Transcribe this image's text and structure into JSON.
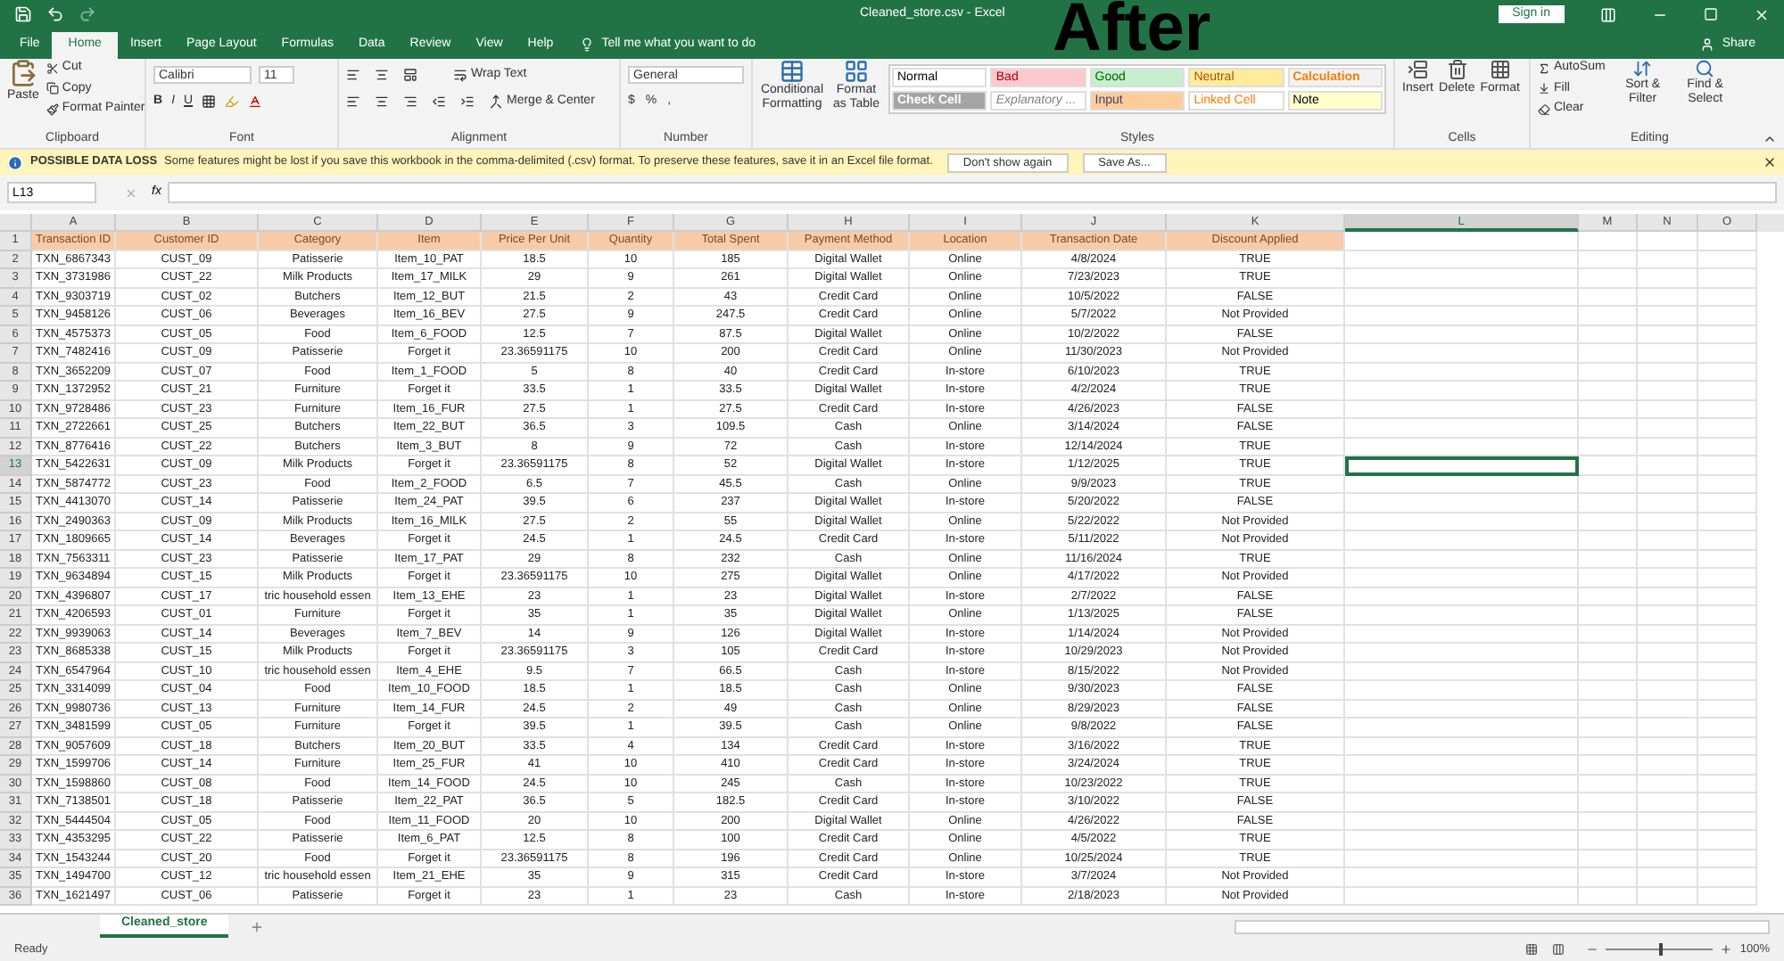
{
  "title_bar": {
    "filename": "Cleaned_store.csv  -  Excel",
    "overlay_label": "After",
    "sign_in": "Sign in",
    "share": "Share"
  },
  "menu_tabs": [
    {
      "label": "File",
      "selected": false
    },
    {
      "label": "Home",
      "selected": true
    },
    {
      "label": "Insert",
      "selected": false
    },
    {
      "label": "Page Layout",
      "selected": false
    },
    {
      "label": "Formulas",
      "selected": false
    },
    {
      "label": "Data",
      "selected": false
    },
    {
      "label": "Review",
      "selected": false
    },
    {
      "label": "View",
      "selected": false
    },
    {
      "label": "Help",
      "selected": false
    }
  ],
  "tell_me": "Tell me what you want to do",
  "ribbon": {
    "clipboard": {
      "paste": "Paste",
      "cut": "Cut",
      "copy": "Copy",
      "format_painter": "Format Painter",
      "label": "Clipboard"
    },
    "font": {
      "name": "Calibri",
      "size": "11",
      "buttons": [
        "B",
        "I",
        "U"
      ],
      "label": "Font"
    },
    "alignment": {
      "wrap": "Wrap Text",
      "merge": "Merge & Center",
      "label": "Alignment"
    },
    "number": {
      "format": "General",
      "symbols": [
        "$",
        "%",
        ","
      ],
      "label": "Number"
    },
    "styles": {
      "conditional": "Conditional Formatting",
      "format_table": "Format as Table",
      "label": "Styles",
      "cells": [
        {
          "label": "Normal",
          "color": "#ffffff",
          "kind": "normal"
        },
        {
          "label": "Bad",
          "color": "#ffc7ce",
          "kind": "bad"
        },
        {
          "label": "Good",
          "color": "#c6efce",
          "kind": "good"
        },
        {
          "label": "Neutral",
          "color": "#ffeb9c",
          "kind": "neutral"
        },
        {
          "label": "Calculation",
          "color": "#f2f2f2",
          "kind": "calculation"
        },
        {
          "label": "Check Cell",
          "color": "#a5a5a5",
          "kind": "check"
        },
        {
          "label": "Explanatory ...",
          "color": "#ffffff",
          "kind": "explanatory"
        },
        {
          "label": "Input",
          "color": "#ffcc99",
          "kind": "input"
        },
        {
          "label": "Linked Cell",
          "color": "#ffffff",
          "kind": "linked"
        },
        {
          "label": "Note",
          "color": "#ffffcc",
          "kind": "note"
        }
      ]
    },
    "cells": {
      "buttons": [
        "Insert",
        "Delete",
        "Format"
      ],
      "label": "Cells"
    },
    "editing": {
      "autosum": "AutoSum",
      "fill": "Fill",
      "clear": "Clear",
      "sort": "Sort & Filter",
      "find": "Find & Select",
      "label": "Editing"
    }
  },
  "info_bar": {
    "title": "POSSIBLE DATA LOSS",
    "message": "Some features might be lost if you save this workbook in the comma-delimited (.csv) format. To preserve these features, save it in an Excel file format.",
    "buttons": [
      "Don't show again",
      "Save As..."
    ]
  },
  "formula_bar": {
    "name_box": "L13",
    "fx": "fx"
  },
  "sheet": {
    "columns": [
      {
        "label": "A",
        "selected": false
      },
      {
        "label": "B",
        "selected": false
      },
      {
        "label": "C",
        "selected": false
      },
      {
        "label": "D",
        "selected": false
      },
      {
        "label": "E",
        "selected": false
      },
      {
        "label": "F",
        "selected": false
      },
      {
        "label": "G",
        "selected": false
      },
      {
        "label": "H",
        "selected": false
      },
      {
        "label": "I",
        "selected": false
      },
      {
        "label": "J",
        "selected": false
      },
      {
        "label": "K",
        "selected": false
      },
      {
        "label": "L",
        "selected": true
      },
      {
        "label": "M",
        "selected": false
      },
      {
        "label": "N",
        "selected": false
      },
      {
        "label": "O",
        "selected": false
      }
    ],
    "header": {
      "number": "1",
      "cells": [
        "Transaction ID",
        "Customer ID",
        "Category",
        "Item",
        "Price Per Unit",
        "Quantity",
        "Total Spent",
        "Payment Method",
        "Location",
        "Transaction Date",
        "Discount Applied"
      ]
    },
    "rows": [
      {
        "number": "2",
        "selected": false,
        "cells": [
          "TXN_6867343",
          "CUST_09",
          "Patisserie",
          "Item_10_PAT",
          "18.5",
          "10",
          "185",
          "Digital Wallet",
          "Online",
          "4/8/2024",
          "TRUE"
        ]
      },
      {
        "number": "3",
        "selected": false,
        "cells": [
          "TXN_3731986",
          "CUST_22",
          "Milk Products",
          "Item_17_MILK",
          "29",
          "9",
          "261",
          "Digital Wallet",
          "Online",
          "7/23/2023",
          "TRUE"
        ]
      },
      {
        "number": "4",
        "selected": false,
        "cells": [
          "TXN_9303719",
          "CUST_02",
          "Butchers",
          "Item_12_BUT",
          "21.5",
          "2",
          "43",
          "Credit Card",
          "Online",
          "10/5/2022",
          "FALSE"
        ]
      },
      {
        "number": "5",
        "selected": false,
        "cells": [
          "TXN_9458126",
          "CUST_06",
          "Beverages",
          "Item_16_BEV",
          "27.5",
          "9",
          "247.5",
          "Credit Card",
          "Online",
          "5/7/2022",
          "Not Provided"
        ]
      },
      {
        "number": "6",
        "selected": false,
        "cells": [
          "TXN_4575373",
          "CUST_05",
          "Food",
          "Item_6_FOOD",
          "12.5",
          "7",
          "87.5",
          "Digital Wallet",
          "Online",
          "10/2/2022",
          "FALSE"
        ]
      },
      {
        "number": "7",
        "selected": false,
        "cells": [
          "TXN_7482416",
          "CUST_09",
          "Patisserie",
          "Forget it",
          "23.36591175",
          "10",
          "200",
          "Credit Card",
          "Online",
          "11/30/2023",
          "Not Provided"
        ]
      },
      {
        "number": "8",
        "selected": false,
        "cells": [
          "TXN_3652209",
          "CUST_07",
          "Food",
          "Item_1_FOOD",
          "5",
          "8",
          "40",
          "Credit Card",
          "In-store",
          "6/10/2023",
          "TRUE"
        ]
      },
      {
        "number": "9",
        "selected": false,
        "cells": [
          "TXN_1372952",
          "CUST_21",
          "Furniture",
          "Forget it",
          "33.5",
          "1",
          "33.5",
          "Digital Wallet",
          "In-store",
          "4/2/2024",
          "TRUE"
        ]
      },
      {
        "number": "10",
        "selected": false,
        "cells": [
          "TXN_9728486",
          "CUST_23",
          "Furniture",
          "Item_16_FUR",
          "27.5",
          "1",
          "27.5",
          "Credit Card",
          "In-store",
          "4/26/2023",
          "FALSE"
        ]
      },
      {
        "number": "11",
        "selected": false,
        "cells": [
          "TXN_2722661",
          "CUST_25",
          "Butchers",
          "Item_22_BUT",
          "36.5",
          "3",
          "109.5",
          "Cash",
          "Online",
          "3/14/2024",
          "FALSE"
        ]
      },
      {
        "number": "12",
        "selected": false,
        "cells": [
          "TXN_8776416",
          "CUST_22",
          "Butchers",
          "Item_3_BUT",
          "8",
          "9",
          "72",
          "Cash",
          "In-store",
          "12/14/2024",
          "TRUE"
        ]
      },
      {
        "number": "13",
        "selected": true,
        "cells": [
          "TXN_5422631",
          "CUST_09",
          "Milk Products",
          "Forget it",
          "23.36591175",
          "8",
          "52",
          "Digital Wallet",
          "In-store",
          "1/12/2025",
          "TRUE"
        ]
      },
      {
        "number": "14",
        "selected": false,
        "cells": [
          "TXN_5874772",
          "CUST_23",
          "Food",
          "Item_2_FOOD",
          "6.5",
          "7",
          "45.5",
          "Cash",
          "Online",
          "9/9/2023",
          "TRUE"
        ]
      },
      {
        "number": "15",
        "selected": false,
        "cells": [
          "TXN_4413070",
          "CUST_14",
          "Patisserie",
          "Item_24_PAT",
          "39.5",
          "6",
          "237",
          "Digital Wallet",
          "In-store",
          "5/20/2022",
          "FALSE"
        ]
      },
      {
        "number": "16",
        "selected": false,
        "cells": [
          "TXN_2490363",
          "CUST_09",
          "Milk Products",
          "Item_16_MILK",
          "27.5",
          "2",
          "55",
          "Digital Wallet",
          "Online",
          "5/22/2022",
          "Not Provided"
        ]
      },
      {
        "number": "17",
        "selected": false,
        "cells": [
          "TXN_1809665",
          "CUST_14",
          "Beverages",
          "Forget it",
          "24.5",
          "1",
          "24.5",
          "Credit Card",
          "In-store",
          "5/11/2022",
          "Not Provided"
        ]
      },
      {
        "number": "18",
        "selected": false,
        "cells": [
          "TXN_7563311",
          "CUST_23",
          "Patisserie",
          "Item_17_PAT",
          "29",
          "8",
          "232",
          "Cash",
          "Online",
          "11/16/2024",
          "TRUE"
        ]
      },
      {
        "number": "19",
        "selected": false,
        "cells": [
          "TXN_9634894",
          "CUST_15",
          "Milk Products",
          "Forget it",
          "23.36591175",
          "10",
          "275",
          "Digital Wallet",
          "Online",
          "4/17/2022",
          "Not Provided"
        ]
      },
      {
        "number": "20",
        "selected": false,
        "cells": [
          "TXN_4396807",
          "CUST_17",
          "tric household essen",
          "Item_13_EHE",
          "23",
          "1",
          "23",
          "Digital Wallet",
          "In-store",
          "2/7/2022",
          "FALSE"
        ]
      },
      {
        "number": "21",
        "selected": false,
        "cells": [
          "TXN_4206593",
          "CUST_01",
          "Furniture",
          "Forget it",
          "35",
          "1",
          "35",
          "Digital Wallet",
          "Online",
          "1/13/2025",
          "FALSE"
        ]
      },
      {
        "number": "22",
        "selected": false,
        "cells": [
          "TXN_9939063",
          "CUST_14",
          "Beverages",
          "Item_7_BEV",
          "14",
          "9",
          "126",
          "Digital Wallet",
          "In-store",
          "1/14/2024",
          "Not Provided"
        ]
      },
      {
        "number": "23",
        "selected": false,
        "cells": [
          "TXN_8685338",
          "CUST_15",
          "Milk Products",
          "Forget it",
          "23.36591175",
          "3",
          "105",
          "Credit Card",
          "In-store",
          "10/29/2023",
          "Not Provided"
        ]
      },
      {
        "number": "24",
        "selected": false,
        "cells": [
          "TXN_6547964",
          "CUST_10",
          "tric household essen",
          "Item_4_EHE",
          "9.5",
          "7",
          "66.5",
          "Cash",
          "In-store",
          "8/15/2022",
          "Not Provided"
        ]
      },
      {
        "number": "25",
        "selected": false,
        "cells": [
          "TXN_3314099",
          "CUST_04",
          "Food",
          "Item_10_FOOD",
          "18.5",
          "1",
          "18.5",
          "Cash",
          "Online",
          "9/30/2023",
          "FALSE"
        ]
      },
      {
        "number": "26",
        "selected": false,
        "cells": [
          "TXN_9980736",
          "CUST_13",
          "Furniture",
          "Item_14_FUR",
          "24.5",
          "2",
          "49",
          "Cash",
          "Online",
          "8/29/2023",
          "FALSE"
        ]
      },
      {
        "number": "27",
        "selected": false,
        "cells": [
          "TXN_3481599",
          "CUST_05",
          "Furniture",
          "Forget it",
          "39.5",
          "1",
          "39.5",
          "Cash",
          "Online",
          "9/8/2022",
          "FALSE"
        ]
      },
      {
        "number": "28",
        "selected": false,
        "cells": [
          "TXN_9057609",
          "CUST_18",
          "Butchers",
          "Item_20_BUT",
          "33.5",
          "4",
          "134",
          "Credit Card",
          "In-store",
          "3/16/2022",
          "TRUE"
        ]
      },
      {
        "number": "29",
        "selected": false,
        "cells": [
          "TXN_1599706",
          "CUST_14",
          "Furniture",
          "Item_25_FUR",
          "41",
          "10",
          "410",
          "Credit Card",
          "In-store",
          "3/24/2024",
          "TRUE"
        ]
      },
      {
        "number": "30",
        "selected": false,
        "cells": [
          "TXN_1598860",
          "CUST_08",
          "Food",
          "Item_14_FOOD",
          "24.5",
          "10",
          "245",
          "Cash",
          "In-store",
          "10/23/2022",
          "TRUE"
        ]
      },
      {
        "number": "31",
        "selected": false,
        "cells": [
          "TXN_7138501",
          "CUST_18",
          "Patisserie",
          "Item_22_PAT",
          "36.5",
          "5",
          "182.5",
          "Credit Card",
          "In-store",
          "3/10/2022",
          "FALSE"
        ]
      },
      {
        "number": "32",
        "selected": false,
        "cells": [
          "TXN_5444504",
          "CUST_05",
          "Food",
          "Item_11_FOOD",
          "20",
          "10",
          "200",
          "Digital Wallet",
          "Online",
          "4/26/2022",
          "FALSE"
        ]
      },
      {
        "number": "33",
        "selected": false,
        "cells": [
          "TXN_4353295",
          "CUST_22",
          "Patisserie",
          "Item_6_PAT",
          "12.5",
          "8",
          "100",
          "Credit Card",
          "Online",
          "4/5/2022",
          "TRUE"
        ]
      },
      {
        "number": "34",
        "selected": false,
        "cells": [
          "TXN_1543244",
          "CUST_20",
          "Food",
          "Forget it",
          "23.36591175",
          "8",
          "196",
          "Credit Card",
          "Online",
          "10/25/2024",
          "TRUE"
        ]
      },
      {
        "number": "35",
        "selected": false,
        "cells": [
          "TXN_1494700",
          "CUST_12",
          "tric household essen",
          "Item_21_EHE",
          "35",
          "9",
          "315",
          "Credit Card",
          "In-store",
          "3/7/2024",
          "Not Provided"
        ]
      },
      {
        "number": "36",
        "selected": false,
        "cells": [
          "TXN_1621497",
          "CUST_06",
          "Patisserie",
          "Forget it",
          "23",
          "1",
          "23",
          "Cash",
          "In-store",
          "2/18/2023",
          "Not Provided"
        ]
      }
    ]
  },
  "sheet_tabs": [
    {
      "label": "Cleaned_store",
      "selected": true
    }
  ],
  "status_bar": {
    "status": "Ready",
    "zoom": "100%",
    "zoom_slider": {
      "level": 0.5
    }
  }
}
